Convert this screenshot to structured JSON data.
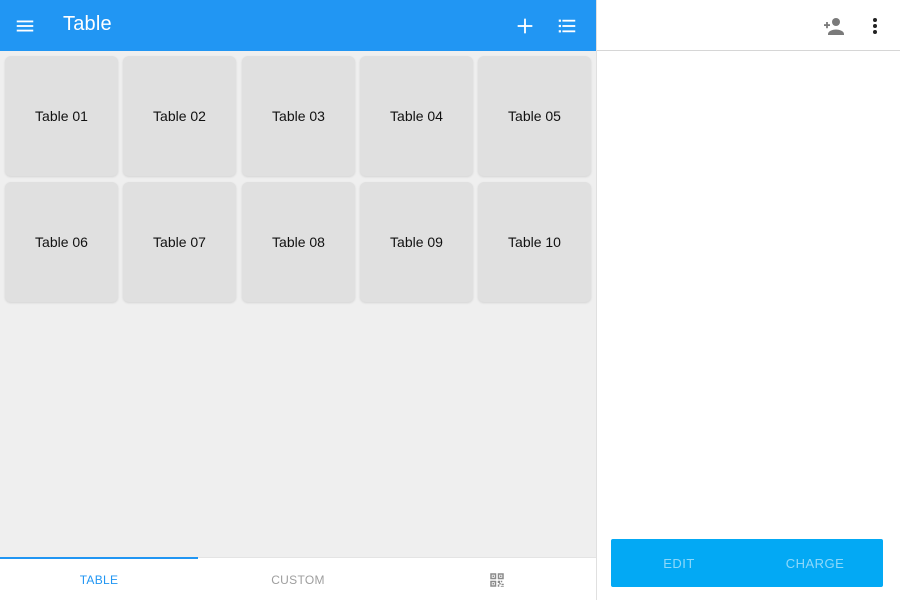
{
  "appbar": {
    "title": "Table",
    "menu_icon": "menu-icon",
    "add_icon": "plus-icon",
    "list_icon": "list-icon"
  },
  "tables": [
    {
      "label": "Table 01"
    },
    {
      "label": "Table 02"
    },
    {
      "label": "Table 03"
    },
    {
      "label": "Table 04"
    },
    {
      "label": "Table 05"
    },
    {
      "label": "Table 06"
    },
    {
      "label": "Table 07"
    },
    {
      "label": "Table 08"
    },
    {
      "label": "Table 09"
    },
    {
      "label": "Table 10"
    }
  ],
  "bottom_nav": {
    "tab_table": "TABLE",
    "tab_custom": "CUSTOM",
    "tab_qr_icon": "qr-code-icon"
  },
  "right_panel": {
    "add_person_icon": "add-person-icon",
    "more_icon": "more-vert-icon",
    "edit_label": "EDIT",
    "charge_label": "CHARGE"
  },
  "colors": {
    "primary": "#2196f3",
    "action_bar": "#03a9f4",
    "tile": "#e0e0e0",
    "background": "#efefef"
  }
}
